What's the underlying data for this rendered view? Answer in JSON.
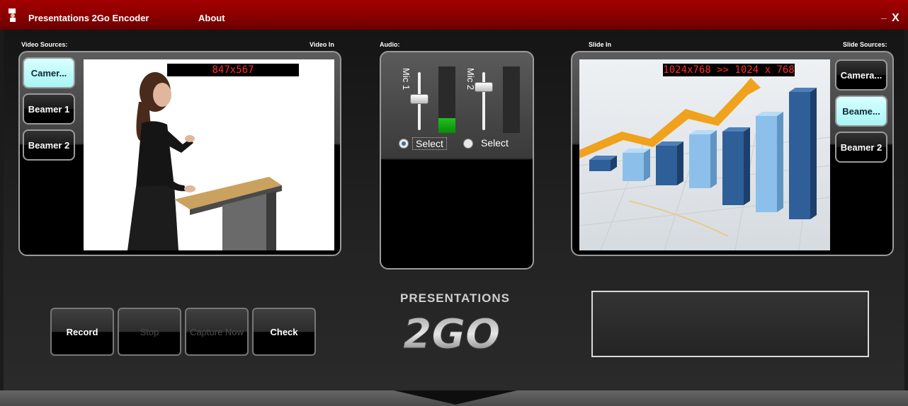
{
  "window": {
    "title": "Presentations 2Go Encoder",
    "menu_about": "About",
    "minimize": "_",
    "close": "X"
  },
  "video": {
    "sources_label": "Video Sources:",
    "in_label": "Video In",
    "resolution": "847x567",
    "sources": [
      "Camer...",
      "Beamer 1",
      "Beamer 2"
    ],
    "active_index": 0
  },
  "audio": {
    "label": "Audio:",
    "mics": [
      {
        "name": "Mic 1",
        "slider_level": 0.55,
        "meter_level": 0.22,
        "select_label": "Select",
        "selected": true
      },
      {
        "name": "Mic 2",
        "slider_level": 0.8,
        "meter_level": 0.0,
        "select_label": "Select",
        "selected": false
      }
    ]
  },
  "slide": {
    "in_label": "Slide In",
    "sources_label": "Slide Sources:",
    "resolution": "1024x768 >> 1024 x 768",
    "sources": [
      "Camera...",
      "Beame...",
      "Beamer 2"
    ],
    "active_index": 1,
    "chart_bar_levels": [
      0.08,
      0.2,
      0.28,
      0.38,
      0.52,
      0.68,
      0.9
    ]
  },
  "actions": {
    "record": "Record",
    "stop": "Stop",
    "capture_now": "Capture Now",
    "check": "Check"
  },
  "logo": {
    "top": "PRESENTATIONS",
    "bottom": "2GO"
  },
  "colors": {
    "titlebar": "#8a0000",
    "active_button": "#a9f5f5",
    "resolution_text": "#ff2a2a",
    "meter": "#1ec21e"
  }
}
